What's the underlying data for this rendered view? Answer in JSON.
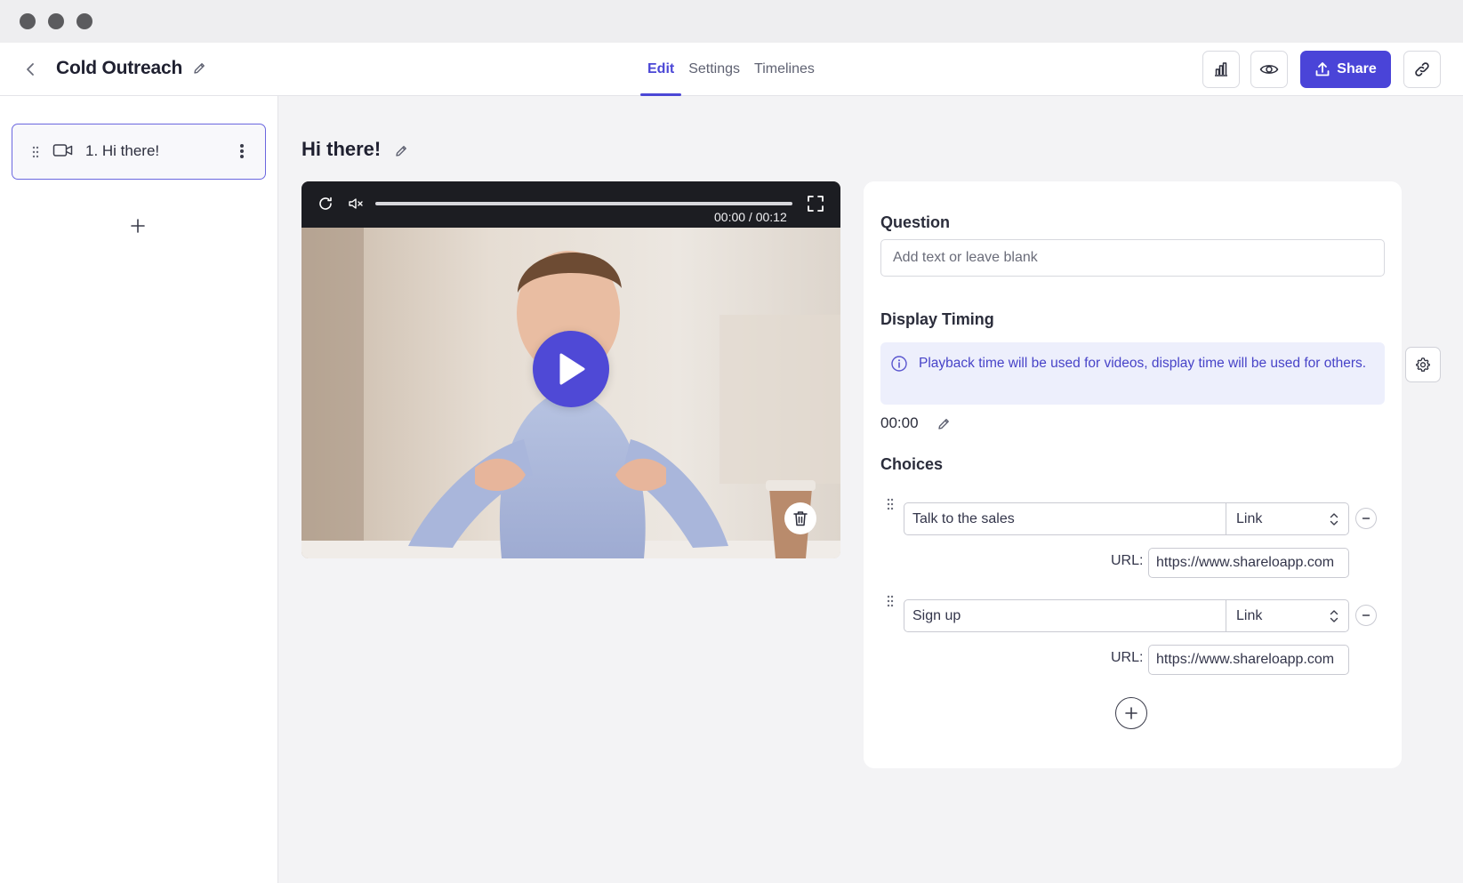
{
  "window": {
    "controls": [
      "close",
      "minimize",
      "maximize"
    ]
  },
  "header": {
    "project_title": "Cold Outreach",
    "tabs": [
      {
        "label": "Edit",
        "active": true
      },
      {
        "label": "Settings",
        "active": false
      },
      {
        "label": "Timelines",
        "active": false
      }
    ],
    "share_label": "Share",
    "icons": [
      "back-arrow-icon",
      "pencil-icon",
      "bar-chart-icon",
      "eye-icon",
      "upload-icon",
      "link-icon"
    ]
  },
  "sidebar": {
    "items": [
      {
        "label": "1. Hi there!",
        "type": "video"
      }
    ]
  },
  "step": {
    "title": "Hi there!"
  },
  "video": {
    "time": "00:00 / 00:12",
    "progress": 0,
    "muted": true
  },
  "panel": {
    "question_label": "Question",
    "question_placeholder": "Add text or leave blank",
    "timing_label": "Display Timing",
    "timing_info": "Playback time will be used for videos, display time will be used for others.",
    "timing_value": "00:00",
    "choices_label": "Choices",
    "url_label": "URL:",
    "choices": [
      {
        "text": "Talk to the sales",
        "type": "Link",
        "url": "https://www.shareloapp.com"
      },
      {
        "text": "Sign up",
        "type": "Link",
        "url": "https://www.shareloapp.com"
      }
    ]
  },
  "colors": {
    "accent": "#4a44d8",
    "info_bg": "#edeffc",
    "info_text": "#4743c8",
    "page_bg": "#f3f3f5"
  }
}
